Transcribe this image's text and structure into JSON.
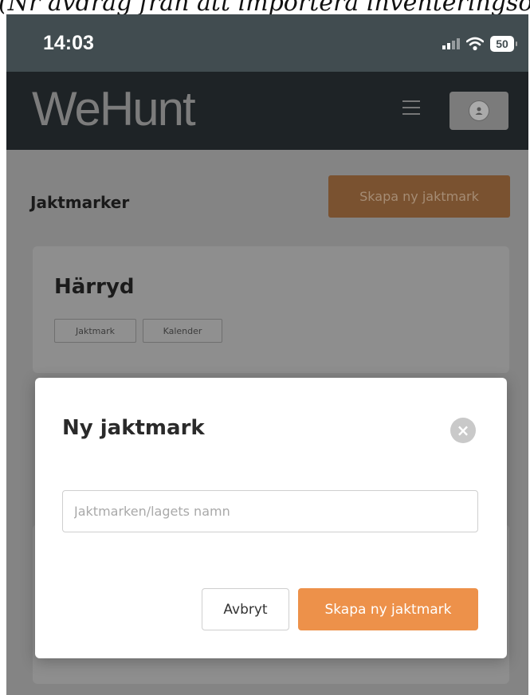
{
  "caption": "(Nr avdrag från att importera inventeringsom",
  "status_bar": {
    "time": "14:03",
    "battery": "50",
    "icons": [
      "signal-icon",
      "wifi-icon",
      "battery-icon"
    ]
  },
  "navbar": {
    "logo": "WeHunt",
    "menu_icon": "hamburger-menu-icon",
    "avatar_icon": "user-avatar-icon"
  },
  "page": {
    "title": "Jaktmarker",
    "create_button": "Skapa ny jaktmark"
  },
  "card": {
    "title": "Härryd",
    "tags": [
      "Jaktmark",
      "Kalender"
    ]
  },
  "modal": {
    "title": "Ny jaktmark",
    "close_icon": "close-circle-icon",
    "name_input": {
      "placeholder": "Jaktmarken/lagets namn",
      "value": ""
    },
    "cancel_label": "Avbryt",
    "create_label": "Skapa ny jaktmark"
  },
  "colors": {
    "accent": "#ed914a",
    "navbar": "#1e2326",
    "status_bar": "#414c50"
  }
}
